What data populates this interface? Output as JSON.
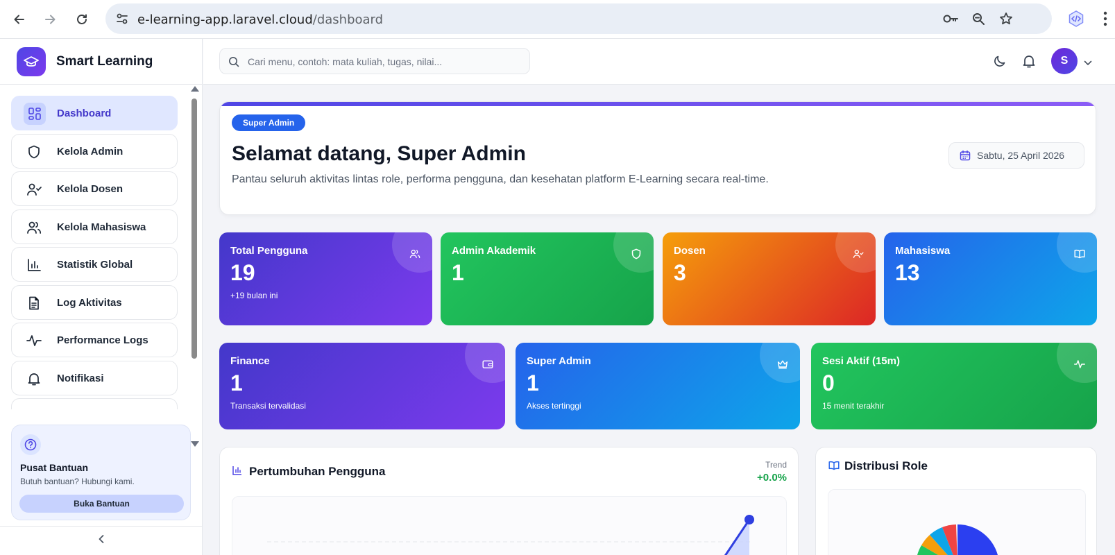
{
  "browser": {
    "url_host": "e-learning-app.laravel.cloud",
    "url_path": "/dashboard"
  },
  "sidebar": {
    "brand": "Smart Learning",
    "items": [
      {
        "label": "Dashboard",
        "icon": "grid-icon",
        "active": true
      },
      {
        "label": "Kelola Admin",
        "icon": "shield-icon"
      },
      {
        "label": "Kelola Dosen",
        "icon": "user-check-icon"
      },
      {
        "label": "Kelola Mahasiswa",
        "icon": "users-icon"
      },
      {
        "label": "Statistik Global",
        "icon": "bar-chart-icon"
      },
      {
        "label": "Log Aktivitas",
        "icon": "file-text-icon"
      },
      {
        "label": "Performance Logs",
        "icon": "activity-icon"
      },
      {
        "label": "Notifikasi",
        "icon": "bell-icon"
      }
    ],
    "help": {
      "title": "Pusat Bantuan",
      "subtitle": "Butuh bantuan? Hubungi kami.",
      "button": "Buka Bantuan"
    }
  },
  "header": {
    "search_placeholder": "Cari menu, contoh: mata kuliah, tugas, nilai...",
    "avatar_initial": "S"
  },
  "welcome": {
    "badge": "Super Admin",
    "title": "Selamat datang, Super Admin",
    "description": "Pantau seluruh aktivitas lintas role, performa pengguna, dan kesehatan platform E-Learning secara real-time.",
    "date": "Sabtu, 25 April 2026"
  },
  "stats_row1": [
    {
      "label": "Total Pengguna",
      "value": "19",
      "sub": "+19 bulan ini",
      "icon": "users-icon",
      "gradient": [
        "#4338ca",
        "#7c3aed"
      ]
    },
    {
      "label": "Admin Akademik",
      "value": "1",
      "sub": "",
      "icon": "shield-icon",
      "gradient": [
        "#22c55e",
        "#16a34a"
      ]
    },
    {
      "label": "Dosen",
      "value": "3",
      "sub": "",
      "icon": "user-check-icon",
      "gradient": [
        "#f59e0b",
        "#dc2626"
      ]
    },
    {
      "label": "Mahasiswa",
      "value": "13",
      "sub": "",
      "icon": "book-icon",
      "gradient": [
        "#2563eb",
        "#0ea5e9"
      ]
    }
  ],
  "stats_row2": [
    {
      "label": "Finance",
      "value": "1",
      "sub": "Transaksi tervalidasi",
      "icon": "wallet-icon",
      "gradient": [
        "#4338ca",
        "#7c3aed"
      ]
    },
    {
      "label": "Super Admin",
      "value": "1",
      "sub": "Akses tertinggi",
      "icon": "crown-icon",
      "gradient": [
        "#2563eb",
        "#0ea5e9"
      ]
    },
    {
      "label": "Sesi Aktif (15m)",
      "value": "0",
      "sub": "15 menit terakhir",
      "icon": "activity-icon",
      "gradient": [
        "#22c55e",
        "#16a34a"
      ]
    }
  ],
  "growth": {
    "title": "Pertumbuhan Pengguna",
    "trend_label": "Trend",
    "trend_value": "+0.0%"
  },
  "distribution": {
    "title": "Distribusi Role"
  },
  "colors": {
    "primary": "#4f46e5",
    "success": "#16a34a",
    "badge": "#2563eb"
  }
}
